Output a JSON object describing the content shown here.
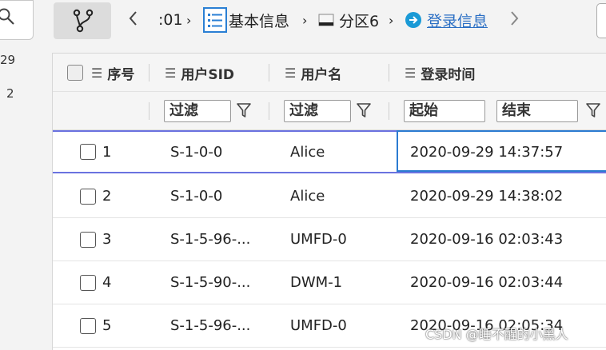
{
  "left_panel": {
    "numbers": [
      "29",
      "2"
    ]
  },
  "toolbar": {
    "branch_icon": "branch-icon",
    "back_icon": "chevron-left-icon",
    "forward_icon": "chevron-right-icon"
  },
  "breadcrumb": [
    {
      "label": ":01",
      "icon": ""
    },
    {
      "label": "基本信息",
      "icon": "list-icon"
    },
    {
      "label": "分区6",
      "icon": "drive-icon"
    },
    {
      "label": "登录信息",
      "icon": "login-icon"
    }
  ],
  "grid": {
    "columns": [
      {
        "key": "index",
        "label": "序号"
      },
      {
        "key": "sid",
        "label": "用户SID"
      },
      {
        "key": "name",
        "label": "用户名"
      },
      {
        "key": "time",
        "label": "登录时间"
      }
    ],
    "filters": {
      "sid_placeholder": "过滤",
      "name_placeholder": "过滤",
      "start_placeholder": "起始",
      "end_placeholder": "结束"
    },
    "rows": [
      {
        "index": "1",
        "sid": "S-1-0-0",
        "name": "Alice",
        "time": "2020-09-29 14:37:57"
      },
      {
        "index": "2",
        "sid": "S-1-0-0",
        "name": "Alice",
        "time": "2020-09-29 14:38:02"
      },
      {
        "index": "3",
        "sid": "S-1-5-96-...",
        "name": "UMFD-0",
        "time": "2020-09-16 02:03:43"
      },
      {
        "index": "4",
        "sid": "S-1-5-90-...",
        "name": "DWM-1",
        "time": "2020-09-16 02:03:44"
      },
      {
        "index": "5",
        "sid": "S-1-5-96-...",
        "name": "UMFD-0",
        "time": "2020-09-16 02:05:34"
      }
    ]
  },
  "watermark": "CSDN @睡不醒的小黑人"
}
